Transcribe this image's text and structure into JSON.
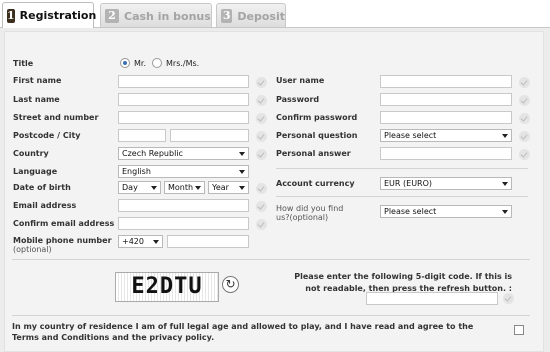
{
  "tabs": [
    {
      "num": "1",
      "label": "Registration"
    },
    {
      "num": "2",
      "label": "Cash in bonus"
    },
    {
      "num": "3",
      "label": "Deposit"
    }
  ],
  "form": {
    "title_label": "Title",
    "title_mr": "Mr.",
    "title_mrs": "Mrs./Ms.",
    "first_name": "First name",
    "last_name": "Last name",
    "street": "Street and number",
    "postcode_city": "Postcode / City",
    "country": "Country",
    "country_value": "Czech Republic",
    "language": "Language",
    "language_value": "English",
    "dob": "Date of birth",
    "dob_day": "Day",
    "dob_month": "Month",
    "dob_year": "Year",
    "email": "Email address",
    "confirm_email": "Confirm email address",
    "mobile": "Mobile phone number",
    "mobile_optional": "(optional)",
    "mobile_prefix": "+420",
    "username": "User name",
    "password": "Password",
    "confirm_password": "Confirm password",
    "question": "Personal question",
    "question_value": "Please select",
    "answer": "Personal answer",
    "currency": "Account currency",
    "currency_value": "EUR (EURO)",
    "find_us": "How did you find",
    "find_us_2": "us?(optional)",
    "find_us_value": "Please select"
  },
  "captcha": {
    "code": "E2DTU",
    "refresh_icon": "↻",
    "instructions": "Please enter the following 5-digit code. If this is not readable, then press the refresh button. :"
  },
  "agree_text": "In my country of residence I am of full legal age and allowed to play, and I have read and agree to the Terms and Conditions and the privacy policy."
}
